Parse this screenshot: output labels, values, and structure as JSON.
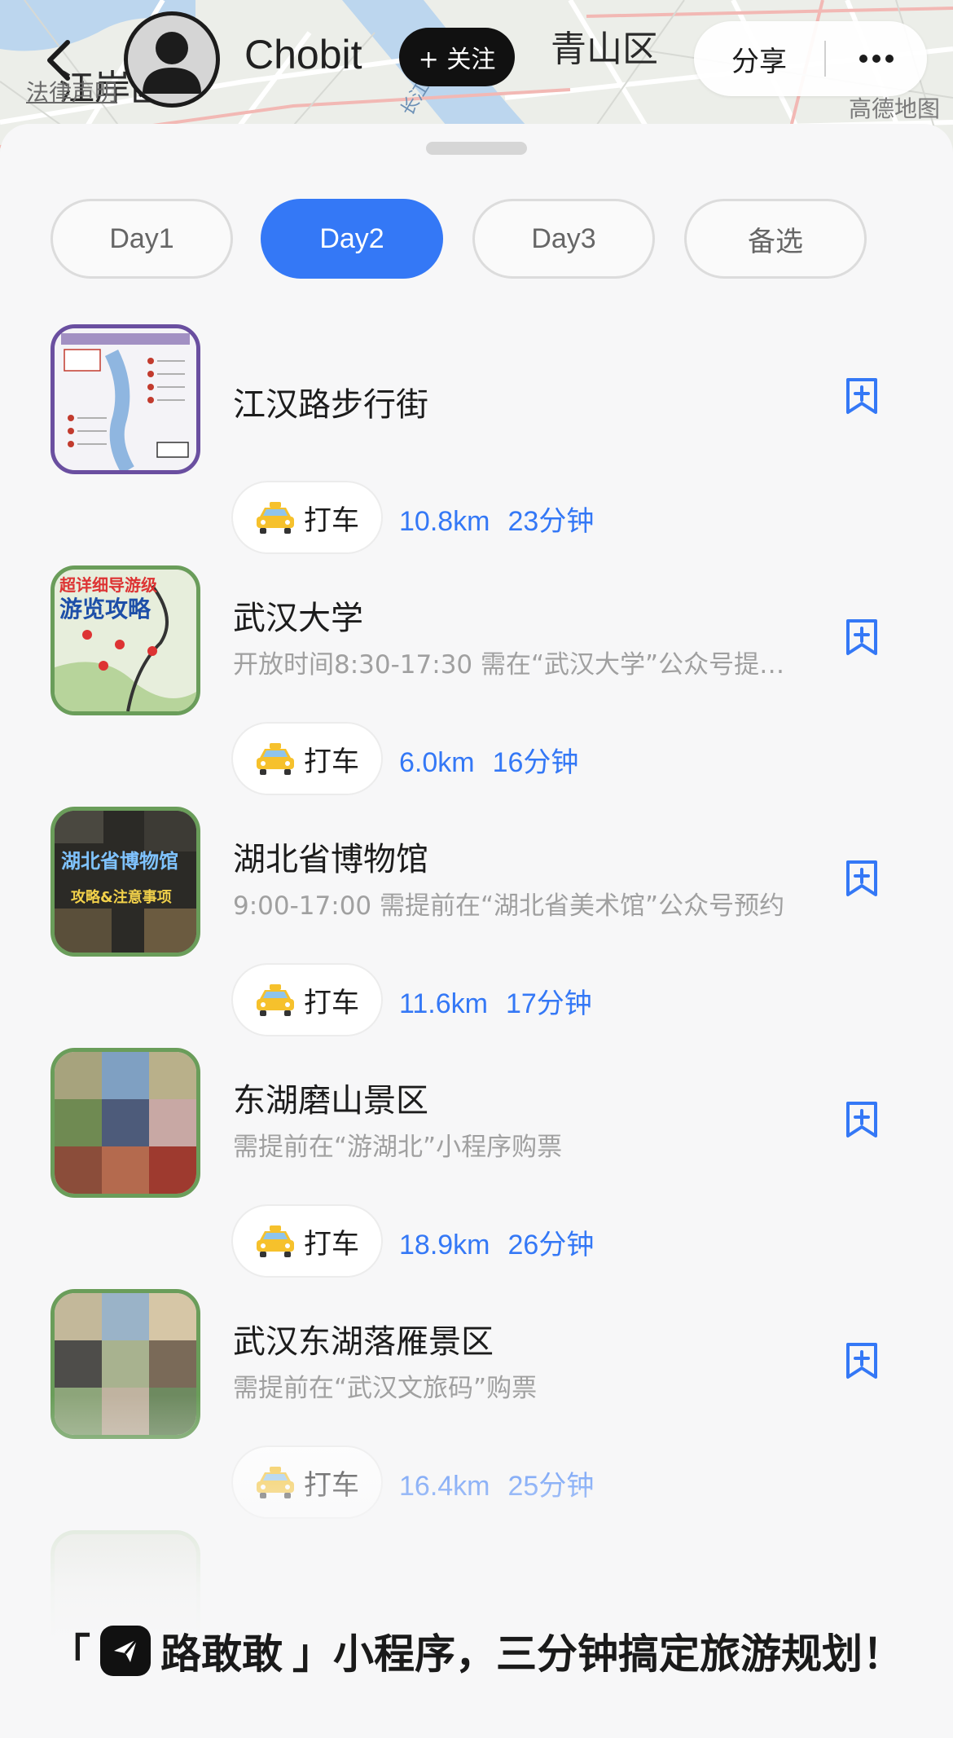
{
  "header": {
    "map_labels": [
      "江岸区",
      "法律声明",
      "青山区",
      "长江"
    ],
    "map_provider": "高德地图",
    "username": "Chobit",
    "follow_label": "+ 关注",
    "share_label": "分享",
    "more_label": "•••"
  },
  "tabs": [
    {
      "label": "Day1",
      "active": false
    },
    {
      "label": "Day2",
      "active": true
    },
    {
      "label": "Day3",
      "active": false
    },
    {
      "label": "备选",
      "active": false
    }
  ],
  "items": [
    {
      "title": "江汉路步行街",
      "note": "",
      "taxi_label": "打车",
      "distance": "10.8km",
      "duration": "23分钟"
    },
    {
      "title": "武汉大学",
      "note": "开放时间8:30-17:30  需在“武汉大学”公众号提…",
      "taxi_label": "打车",
      "distance": "6.0km",
      "duration": "16分钟"
    },
    {
      "title": "湖北省博物馆",
      "note": "9:00-17:00  需提前在“湖北省美术馆”公众号预约",
      "taxi_label": "打车",
      "distance": "11.6km",
      "duration": "17分钟"
    },
    {
      "title": "东湖磨山景区",
      "note": "需提前在“游湖北”小程序购票",
      "taxi_label": "打车",
      "distance": "18.9km",
      "duration": "26分钟"
    },
    {
      "title": "武汉东湖落雁景区",
      "note": "需提前在“武汉文旅码”购票",
      "taxi_label": "打车",
      "distance": "16.4km",
      "duration": "25分钟"
    }
  ],
  "thumb_text": {
    "item2_line1": "超详细导游级",
    "item2_line2": "游览攻略",
    "item3_line1": "湖北省博物馆",
    "item3_line2": "攻略&注意事项"
  },
  "promo": {
    "prefix": "「",
    "name": "路敢敢",
    "suffix": "」小程序，三分钟搞定旅游规划！"
  },
  "colors": {
    "accent": "#3478f6",
    "tab_active_text": "#ffffff",
    "text_primary": "#1c1c1c",
    "text_secondary": "#a0a0a0"
  }
}
